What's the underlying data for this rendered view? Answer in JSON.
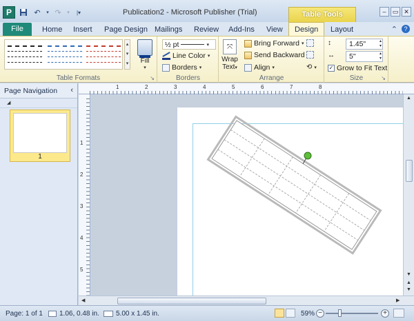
{
  "app": {
    "icon_letter": "P",
    "title": "Publication2 - Microsoft Publisher (Trial)",
    "context_header": "Table Tools",
    "window_buttons": [
      "–",
      "▭",
      "✕"
    ]
  },
  "tabs": {
    "file": "File",
    "items": [
      "Home",
      "Insert",
      "Page Design",
      "Mailings",
      "Review",
      "Add-Ins",
      "View"
    ],
    "active": "Design",
    "layout": "Layout"
  },
  "ribbon": {
    "table_formats_label": "Table Formats",
    "fill_label": "Fill",
    "line_weight": "½ pt",
    "line_color": "Line Color",
    "borders_btn": "Borders",
    "borders_label": "Borders",
    "wrap_text": "Wrap",
    "wrap_text2": "Text",
    "bring_forward": "Bring Forward",
    "send_backward": "Send Backward",
    "align": "Align",
    "arrange_label": "Arrange",
    "height": "1.45\"",
    "width": "5\"",
    "grow_to_fit": "Grow to Fit Text",
    "size_label": "Size"
  },
  "nav": {
    "title": "Page Navigation",
    "collapse_icon": "‹",
    "page_number": "1"
  },
  "ruler": {
    "h_numbers": [
      "1",
      "2",
      "3",
      "4",
      "5",
      "6",
      "7",
      "8"
    ],
    "v_numbers": [
      "1",
      "2",
      "3",
      "4",
      "5"
    ]
  },
  "status": {
    "page": "Page: 1 of 1",
    "position": "1.06, 0.48 in.",
    "size": "5.00 x 1.45 in.",
    "zoom": "59%"
  },
  "colors": {
    "file_tab": "#1f8a7a",
    "context_tab": "#e9d34a",
    "ribbon_bg": "#f5efc9"
  }
}
